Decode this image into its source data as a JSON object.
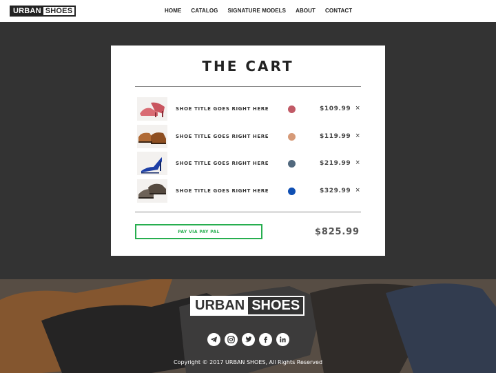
{
  "header": {
    "logo_part1": "URBAN",
    "logo_part2": "SHOES",
    "nav": [
      "HOME",
      "CATALOG",
      "SIGNATURE MODELS",
      "ABOUT",
      "CONTACT"
    ]
  },
  "cart": {
    "title": "THE CART",
    "items": [
      {
        "title": "SHOE TITLE GOES RIGHT HERE",
        "price": "$109.99",
        "color": "#c15a66",
        "thumb": "pink-pumps",
        "remove": "×"
      },
      {
        "title": "SHOE TITLE GOES RIGHT HERE",
        "price": "$119.99",
        "color": "#d69a78",
        "thumb": "brown-oxfords",
        "remove": "×"
      },
      {
        "title": "SHOE TITLE GOES RIGHT HERE",
        "price": "$219.99",
        "color": "#52697e",
        "thumb": "blue-pumps",
        "remove": "×"
      },
      {
        "title": "SHOE TITLE GOES RIGHT HERE",
        "price": "$329.99",
        "color": "#0f4fb3",
        "thumb": "grey-derbies",
        "remove": "×"
      }
    ],
    "pay_button": "PAY VIA PAY PAL",
    "total": "$825.99"
  },
  "footer": {
    "logo_part1": "URBAN",
    "logo_part2": "SHOES",
    "socials": [
      "telegram-icon",
      "instagram-icon",
      "twitter-icon",
      "facebook-icon",
      "linkedin-icon"
    ],
    "copyright": "Copyright © 2017 URBAN SHOES, All Rights Reserved"
  },
  "colors": {
    "accent_green": "#27ae4f",
    "dark_band": "#333333"
  }
}
